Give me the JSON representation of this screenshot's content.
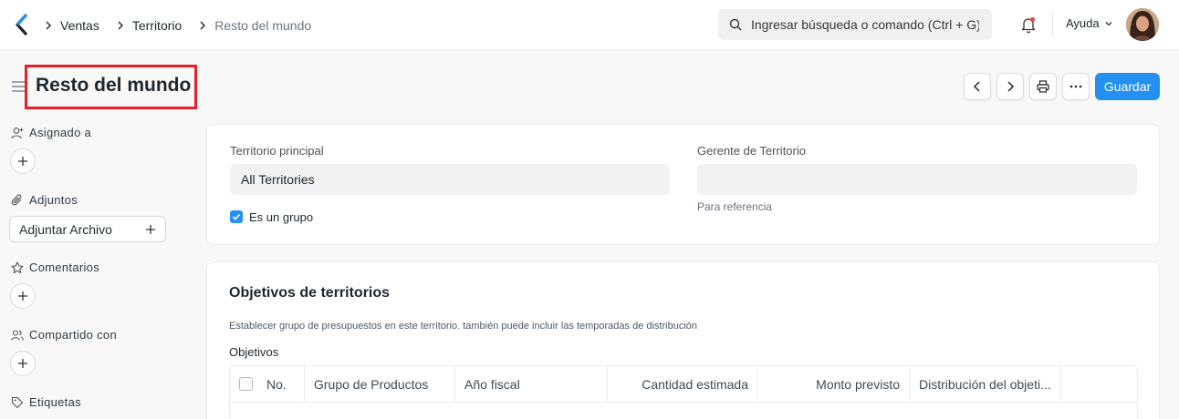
{
  "breadcrumbs": [
    "Ventas",
    "Territorio",
    "Resto del mundo"
  ],
  "search": {
    "placeholder": "Ingresar búsqueda o comando (Ctrl + G)"
  },
  "help_label": "Ayuda",
  "page": {
    "title": "Resto del mundo"
  },
  "actions": {
    "save_label": "Guardar"
  },
  "sidebar": {
    "assigned_label": "Asignado a",
    "attachments_label": "Adjuntos",
    "attach_button": "Adjuntar Archivo",
    "comments_label": "Comentarios",
    "shared_label": "Compartido con",
    "tags_label": "Etiquetas"
  },
  "form": {
    "parent_territory_label": "Territorio principal",
    "parent_territory_value": "All Territories",
    "is_group_label": "Es un grupo",
    "is_group_checked": true,
    "manager_label": "Gerente de Territorio",
    "manager_value": "",
    "manager_help": "Para referencia"
  },
  "targets": {
    "title": "Objetivos de territorios",
    "description": "Establecer grupo de presupuestos en este territorio. también puede incluir las temporadas de distribución",
    "table_label": "Objetivos",
    "columns": [
      "No.",
      "Grupo de Productos",
      "Año fiscal",
      "Cantidad estimada",
      "Monto previsto",
      "Distribución del objeti..."
    ]
  },
  "colors": {
    "primary": "#2490ef",
    "highlight": "#e8202a"
  }
}
